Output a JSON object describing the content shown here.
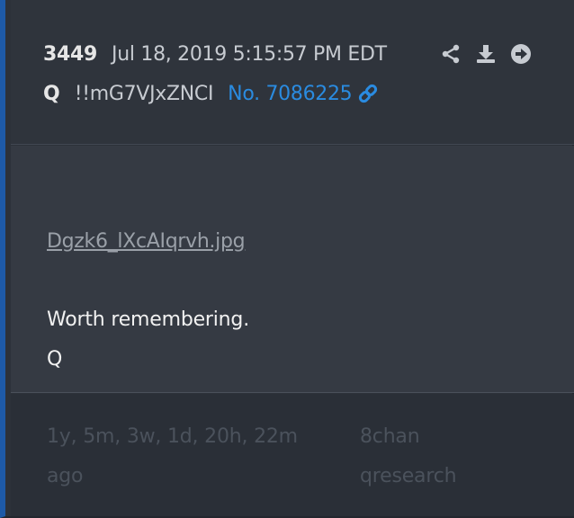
{
  "post": {
    "number": "3449",
    "date": "Jul 18, 2019 5:15:57 PM EDT",
    "author": "Q",
    "tripcode": "!!mG7VJxZNCI",
    "link_text": "No. 7086225"
  },
  "actions": {
    "icons": [
      "share-icon",
      "download-icon",
      "arrow-right-circle-icon"
    ]
  },
  "attachment": {
    "filename": "Dgzk6_lXcAIqrvh.jpg"
  },
  "message": {
    "lines": [
      "Worth remembering.",
      "Q"
    ]
  },
  "footer": {
    "age_line1": "1y, 5m, 3w, 1d, 20h, 22m",
    "age_line2": "ago",
    "board_line1": "8chan",
    "board_line2": "qresearch"
  },
  "colors": {
    "accent_border": "#1e5aa8",
    "link": "#2a8be0",
    "icon": "#c7cbd1"
  }
}
